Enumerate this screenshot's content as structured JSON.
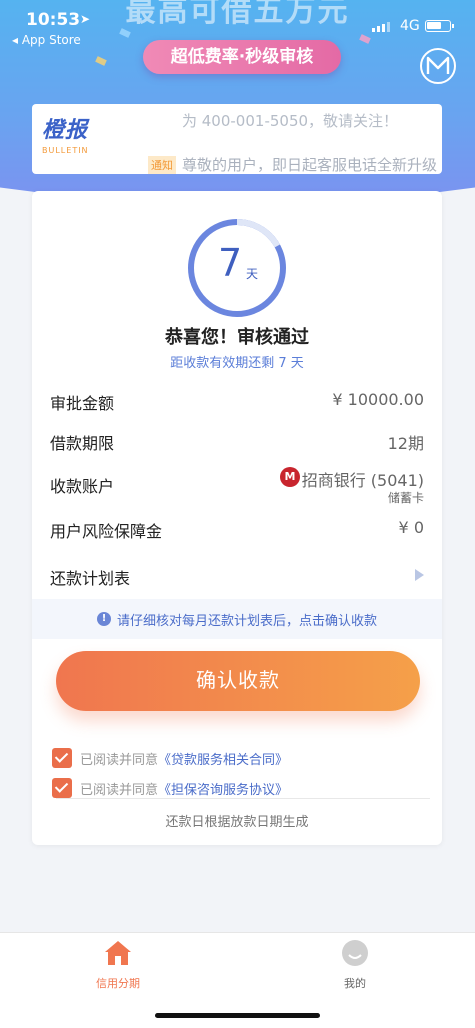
{
  "status_bar": {
    "time": "10:53",
    "back_app": "◂ App Store",
    "network": "4G"
  },
  "hero": {
    "headline": "最高可借五万元",
    "pill": "超低费率·秒级审核"
  },
  "notice": {
    "logo_cn": "橙报",
    "logo_en": "BULLETIN",
    "line1": "为 400-001-5050，敬请关注！",
    "tag": "通知",
    "line2": "尊敬的用户，即日起客服电话全新升级"
  },
  "status": {
    "days": "7",
    "days_unit": "天",
    "days_progress": 0.17,
    "title": "恭喜您！审核通过",
    "subtitle": "距收款有效期还剩 7 天"
  },
  "details": {
    "amount_label": "审批金额",
    "amount_value": "¥ 10000.00",
    "term_label": "借款期限",
    "term_value": "12期",
    "account_label": "收款账户",
    "bank_name": "招商银行 (5041)",
    "bank_card_type": "储蓄卡",
    "risk_label": "用户风险保障金",
    "risk_value": "¥ 0",
    "schedule_label": "还款计划表"
  },
  "tip": "请仔细核对每月还款计划表后，点击确认收款",
  "confirm_button": "确认收款",
  "agreements": [
    {
      "prefix": "已阅读并同意",
      "link": "《贷款服务相关合同》"
    },
    {
      "prefix": "已阅读并同意",
      "link": "《担保咨询服务协议》"
    }
  ],
  "footnote": "还款日根据放款日期生成",
  "tabbar": {
    "tab1": "信用分期",
    "tab2": "我的"
  },
  "colors": {
    "accent_blue": "#3f5fbf",
    "accent_orange": "#f0764f",
    "tab_active": "#f0764f"
  }
}
